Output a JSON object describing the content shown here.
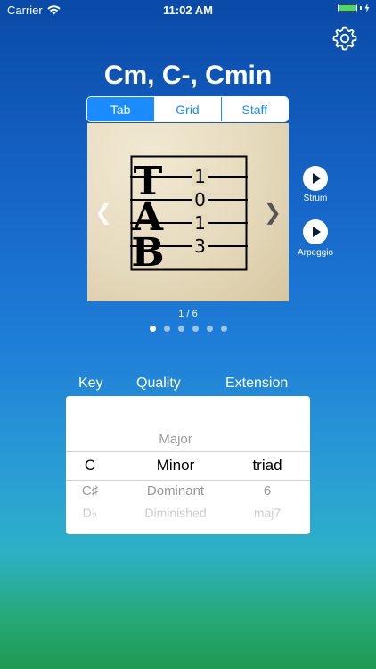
{
  "status_bar": {
    "carrier": "Carrier",
    "time": "11:02 AM",
    "battery_percent": 100,
    "battery_color": "#4cd964"
  },
  "settings_icon": "gear-icon",
  "chord_title": "Cm, C-, Cmin",
  "view_tabs": [
    {
      "label": "Tab",
      "active": true
    },
    {
      "label": "Grid",
      "active": false
    },
    {
      "label": "Staff",
      "active": false
    }
  ],
  "tab_diagram": {
    "letters": [
      "T",
      "A",
      "B"
    ],
    "fret_numbers": [
      "1",
      "0",
      "1",
      "3"
    ]
  },
  "nav": {
    "prev_icon": "chevron-left-icon",
    "next_icon": "chevron-right-icon",
    "next_glyph": "❯",
    "prev_glyph": "❮"
  },
  "play_buttons": [
    {
      "label": "Strum",
      "icon": "play-icon"
    },
    {
      "label": "Arpeggio",
      "icon": "play-icon"
    }
  ],
  "pager": {
    "counter": "1 / 6",
    "current_page": 1,
    "total_pages": 6
  },
  "picker": {
    "headers": {
      "key": "Key",
      "quality": "Quality",
      "extension": "Extension"
    },
    "above_row": {
      "key": "",
      "quality": "Major",
      "extension": ""
    },
    "selected_row": {
      "key": "C",
      "quality": "Minor",
      "extension": "triad"
    },
    "below_row_1": {
      "key": "C♯",
      "quality": "Dominant",
      "extension": "6"
    },
    "below_row_2": {
      "key": "D♭",
      "quality": "Diminished",
      "extension": "maj7"
    }
  },
  "colors": {
    "accent": "#1a8cff",
    "background_top": "#0a4aa8",
    "background_bottom": "#1f9a52"
  }
}
